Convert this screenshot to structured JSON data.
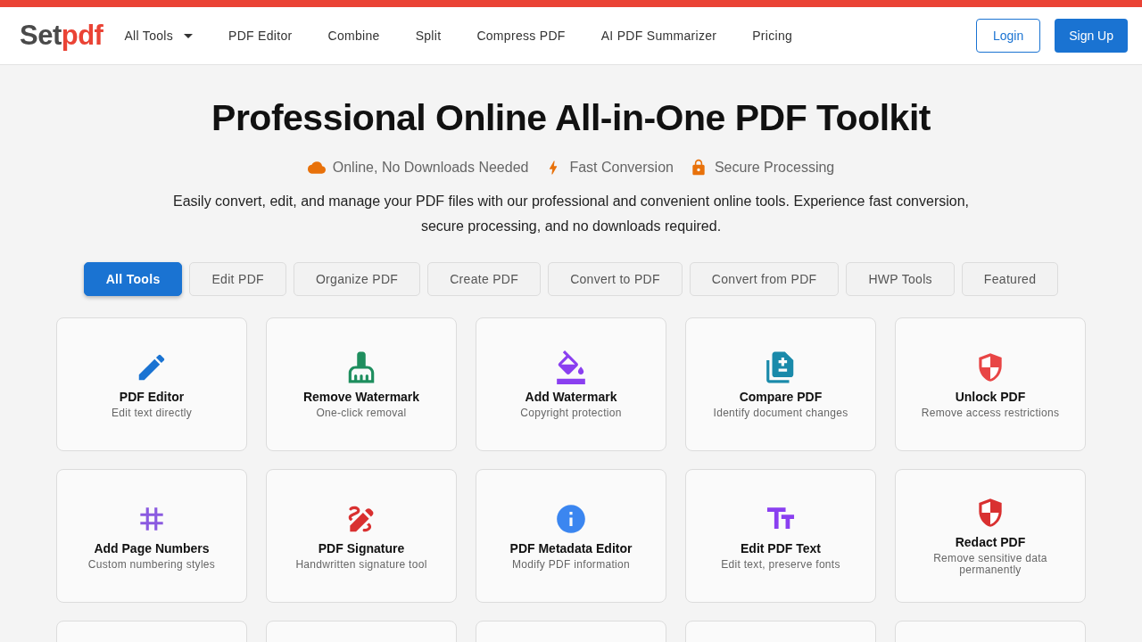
{
  "logo": {
    "part_1": "Set",
    "part_2": "pdf"
  },
  "nav": [
    {
      "label": "All Tools",
      "dropdown": true
    },
    {
      "label": "PDF Editor",
      "dropdown": false
    },
    {
      "label": "Combine",
      "dropdown": false
    },
    {
      "label": "Split",
      "dropdown": false
    },
    {
      "label": "Compress PDF",
      "dropdown": false
    },
    {
      "label": "AI PDF Summarizer",
      "dropdown": false
    },
    {
      "label": "Pricing",
      "dropdown": false
    }
  ],
  "auth": {
    "login": "Login",
    "signup": "Sign Up"
  },
  "hero": {
    "title": "Professional Online All-in-One PDF Toolkit",
    "features": [
      "Online, No Downloads Needed",
      "Fast Conversion",
      "Secure Processing"
    ],
    "description": "Easily convert, edit, and manage your PDF files with our professional and convenient online tools. Experience fast conversion, secure processing, and no downloads required."
  },
  "categories": [
    {
      "label": "All Tools",
      "selected": true
    },
    {
      "label": "Edit PDF",
      "selected": false
    },
    {
      "label": "Organize PDF",
      "selected": false
    },
    {
      "label": "Create PDF",
      "selected": false
    },
    {
      "label": "Convert to PDF",
      "selected": false
    },
    {
      "label": "Convert from PDF",
      "selected": false
    },
    {
      "label": "HWP Tools",
      "selected": false
    },
    {
      "label": "Featured",
      "selected": false
    }
  ],
  "tools": [
    {
      "kind": "tool",
      "name": "PDF Editor",
      "description": "Edit text directly"
    },
    {
      "kind": "tool",
      "name": "Remove Watermark",
      "description": "One-click removal"
    },
    {
      "kind": "tool",
      "name": "Add Watermark",
      "description": "Copyright protection"
    },
    {
      "kind": "tool",
      "name": "Compare PDF",
      "description": "Identify document changes"
    },
    {
      "kind": "tool",
      "name": "Unlock PDF",
      "description": "Remove access restrictions"
    },
    {
      "kind": "tool",
      "name": "Add Page Numbers",
      "description": "Custom numbering styles"
    },
    {
      "kind": "tool",
      "name": "PDF Signature",
      "description": "Handwritten signature tool"
    },
    {
      "kind": "tool",
      "name": "PDF Metadata Editor",
      "description": "Modify PDF information"
    },
    {
      "kind": "tool",
      "name": "Edit PDF Text",
      "description": "Edit text, preserve fonts"
    },
    {
      "kind": "tool",
      "name": "Redact PDF",
      "description": "Remove sensitive data permanently"
    },
    {
      "kind": "empty"
    },
    {
      "kind": "empty"
    },
    {
      "kind": "empty"
    },
    {
      "kind": "empty"
    },
    {
      "kind": "empty"
    }
  ]
}
